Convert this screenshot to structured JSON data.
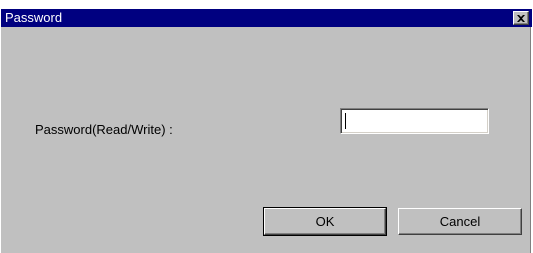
{
  "window": {
    "title": "Password",
    "close_label": "close"
  },
  "form": {
    "password_label": "Password(Read/Write) :",
    "password_value": ""
  },
  "buttons": {
    "ok_label": "OK",
    "cancel_label": "Cancel"
  },
  "icons": {
    "close": "close-icon"
  },
  "colors": {
    "titlebar": "#000080",
    "dialog_face": "#c0c0c0",
    "title_text": "#ffffff"
  }
}
